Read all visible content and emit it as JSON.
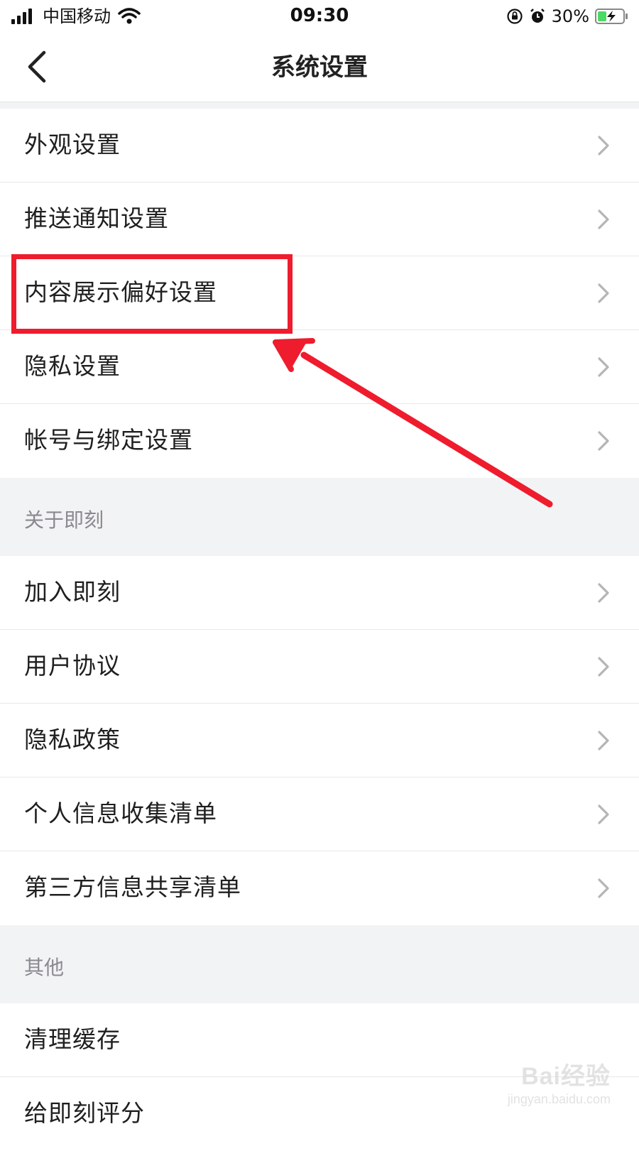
{
  "status_bar": {
    "carrier": "中国移动",
    "time": "09:30",
    "battery": "30%"
  },
  "nav": {
    "title": "系统设置"
  },
  "groups": [
    {
      "items": [
        {
          "label": "外观设置"
        },
        {
          "label": "推送通知设置"
        },
        {
          "label": "内容展示偏好设置"
        },
        {
          "label": "隐私设置"
        },
        {
          "label": "帐号与绑定设置"
        }
      ]
    },
    {
      "header": "关于即刻",
      "items": [
        {
          "label": "加入即刻"
        },
        {
          "label": "用户协议"
        },
        {
          "label": "隐私政策"
        },
        {
          "label": "个人信息收集清单"
        },
        {
          "label": "第三方信息共享清单"
        }
      ]
    },
    {
      "header": "其他",
      "items": [
        {
          "label": "清理缓存"
        },
        {
          "label": "给即刻评分"
        }
      ]
    }
  ],
  "annotation": {
    "color": "#ee1c2d",
    "highlighted_item": "内容展示偏好设置"
  },
  "watermark": {
    "logo": "Bai经验",
    "url": "jingyan.baidu.com"
  }
}
